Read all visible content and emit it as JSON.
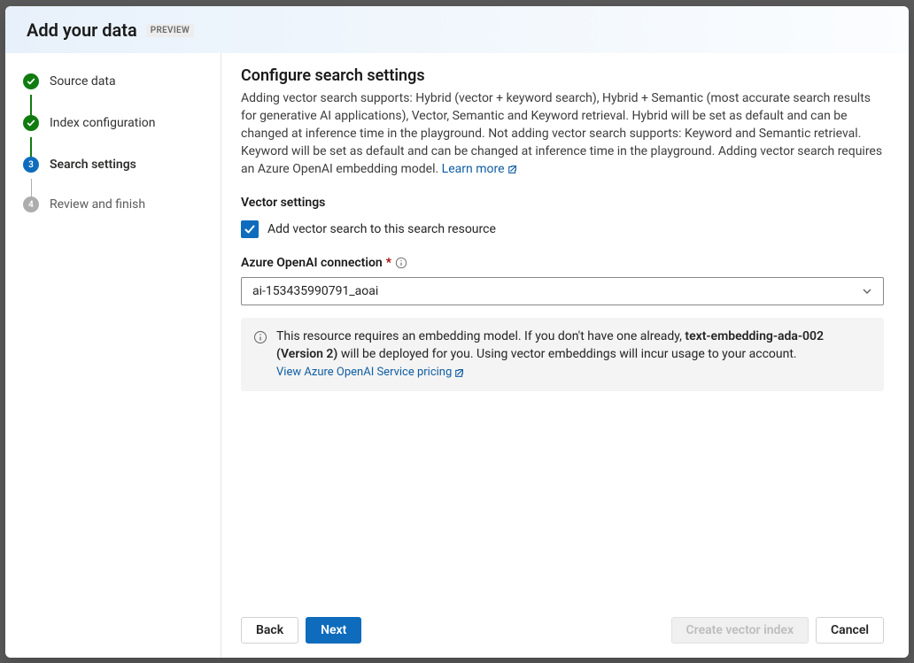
{
  "header": {
    "title": "Add your data",
    "badge": "PREVIEW"
  },
  "wizard": {
    "steps": [
      {
        "label": "Source data",
        "state": "completed"
      },
      {
        "label": "Index configuration",
        "state": "completed"
      },
      {
        "label": "Search settings",
        "state": "current",
        "num": "3"
      },
      {
        "label": "Review and finish",
        "state": "pending",
        "num": "4"
      }
    ]
  },
  "main": {
    "title": "Configure search settings",
    "description": "Adding vector search supports: Hybrid (vector + keyword search), Hybrid + Semantic (most accurate search results for generative AI applications), Vector, Semantic and Keyword retrieval. Hybrid will be set as default and can be changed at inference time in the playground. Not adding vector search supports: Keyword and Semantic retrieval. Keyword will be set as default and can be changed at inference time in the playground. Adding vector search requires an Azure OpenAI embedding model. ",
    "learn_more": "Learn more",
    "vector_settings_title": "Vector settings",
    "checkbox_label": "Add vector search to this search resource",
    "connection_label": "Azure OpenAI connection",
    "connection_value": "ai-153435990791_aoai",
    "info_box_text_pre": "This resource requires an embedding model. If you don't have one already, ",
    "info_box_bold": "text-embedding-ada-002 (Version 2)",
    "info_box_text_post": " will be deployed for you. Using vector embeddings will incur usage to your account. ",
    "info_box_link": "View Azure OpenAI Service pricing"
  },
  "footer": {
    "back": "Back",
    "next": "Next",
    "create": "Create vector index",
    "cancel": "Cancel"
  }
}
